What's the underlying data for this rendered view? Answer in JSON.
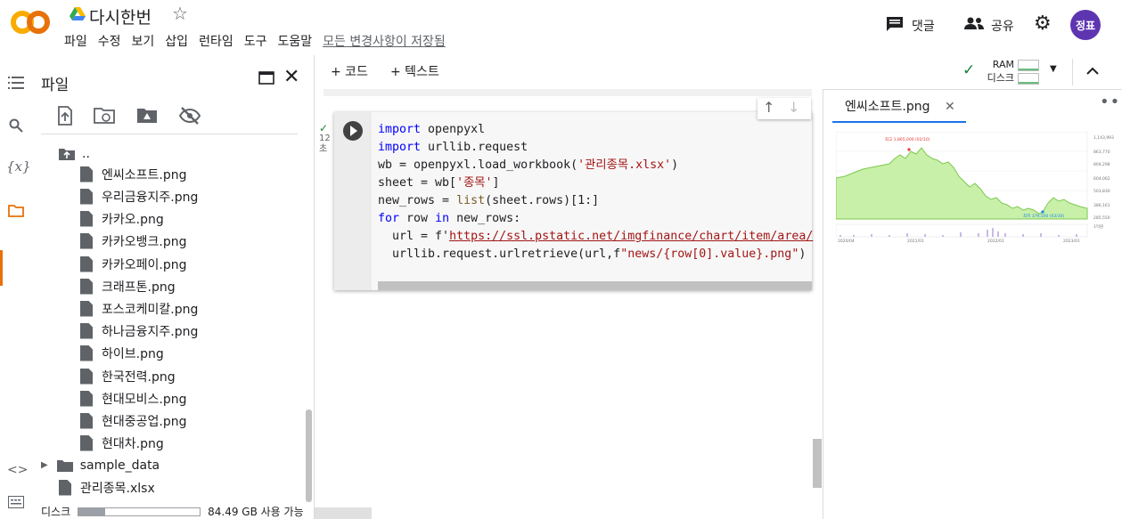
{
  "app": {
    "title": "다시한번",
    "menu": [
      "파일",
      "수정",
      "보기",
      "삽입",
      "런타임",
      "도구",
      "도움말"
    ],
    "saved_status": "모든 변경사항이 저장됨",
    "comment_label": "댓글",
    "share_label": "공유",
    "avatar_text": "정표",
    "accent": "#e8710a"
  },
  "file_panel": {
    "title": "파일",
    "parent_dir": "..",
    "files": [
      "엔씨소프트.png",
      "우리금융지주.png",
      "카카오.png",
      "카카오뱅크.png",
      "카카오페이.png",
      "크래프톤.png",
      "포스코케미칼.png",
      "하나금융지주.png",
      "하이브.png",
      "한국전력.png",
      "현대모비스.png",
      "현대중공업.png",
      "현대차.png"
    ],
    "folder": "sample_data",
    "xlsx": "관리종목.xlsx",
    "disk_label": "디스크",
    "disk_free": "84.49 GB 사용 가능",
    "disk_used_fraction": 0.22
  },
  "toolbar": {
    "add_code": "+ 코드",
    "add_text": "+ 텍스트",
    "ram_label": "RAM",
    "disk_label": "디스크"
  },
  "cell": {
    "exec_time": "12\n초",
    "code_lines": [
      "import openpyxl",
      "import urllib.request",
      "wb = openpyxl.load_workbook('관리종목.xlsx')",
      "sheet = wb['종목']",
      "new_rows = list(sheet.rows)[1:]",
      "for row in new_rows:",
      "  url = f'https://ssl.pstatic.net/imgfinance/chart/item/area/",
      "  urllib.request.urlretrieve(url,f\"news/{row[0].value}.png\")"
    ]
  },
  "viewer": {
    "tab_label": "엔씨소프트.png",
    "max_label": "최고 1,865,000 (02/10)",
    "min_label": "최저 379,500 (03/30)",
    "y_ticks": [
      "1,143,993",
      "863,770",
      "804,298",
      "604,062",
      "503,830",
      "386,161",
      "285,550",
      "1억원"
    ],
    "x_ticks": [
      "2020/04",
      "2021/01",
      "2022/01",
      "2023/01"
    ]
  }
}
